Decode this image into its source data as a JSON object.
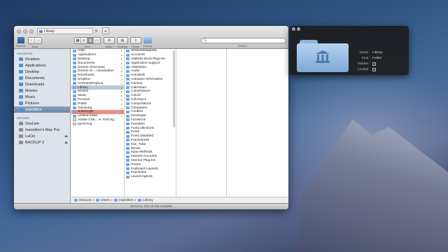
{
  "window": {
    "title": "Library",
    "tab_close": "✕",
    "tab_add": "+"
  },
  "toolbar": {
    "macos_label": "MacOS",
    "back_label": "Back",
    "view_label": "View",
    "action_label": "Action",
    "arrange_label": "Arrange",
    "share_label": "Share",
    "library_label": "Library",
    "search_label": "Search",
    "search_value": "Q"
  },
  "sidebar": {
    "favorites_head": "FAVORITES",
    "favorites": [
      {
        "label": "Dropbox",
        "icon": "dropbox-icon"
      },
      {
        "label": "Applications",
        "icon": "applications-icon"
      },
      {
        "label": "Desktop",
        "icon": "desktop-icon"
      },
      {
        "label": "Documents",
        "icon": "documents-icon"
      },
      {
        "label": "Downloads",
        "icon": "downloads-icon"
      },
      {
        "label": "Movies",
        "icon": "movies-icon"
      },
      {
        "label": "Music",
        "icon": "music-icon"
      },
      {
        "label": "Pictures",
        "icon": "pictures-icon"
      },
      {
        "label": "marioliion",
        "icon": "home-icon"
      }
    ],
    "devices_head": "DEVICES",
    "devices": [
      {
        "label": "OsxLion",
        "icon": "disk-icon"
      },
      {
        "label": "marioliion's Mac Pro",
        "icon": "computer-icon"
      },
      {
        "label": "LaCie",
        "icon": "disk-icon",
        "eject": "⏏"
      },
      {
        "label": "BACKUP 2",
        "icon": "disk-icon",
        "eject": "⏏"
      }
    ]
  },
  "column1": [
    {
      "label": "Adlm",
      "kind": "folder"
    },
    {
      "label": "Applications",
      "kind": "folder"
    },
    {
      "label": "Desktop",
      "kind": "folder"
    },
    {
      "label": "Documents",
      "kind": "folder"
    },
    {
      "label": "Doremi CineAsset",
      "kind": "folder"
    },
    {
      "label": "Doremi Cl... t Evaluation",
      "kind": "folder"
    },
    {
      "label": "Downloads",
      "kind": "folder"
    },
    {
      "label": "Dropbox",
      "kind": "folder"
    },
    {
      "label": "HATeamDropbox",
      "kind": "folder"
    },
    {
      "label": "Library",
      "kind": "folder",
      "selected": true
    },
    {
      "label": "Movies",
      "kind": "folder"
    },
    {
      "label": "Music",
      "kind": "folder"
    },
    {
      "label": "Pictures",
      "kind": "folder"
    },
    {
      "label": "Public",
      "kind": "folder"
    },
    {
      "label": "Samsung",
      "kind": "folder"
    },
    {
      "label": "SolidAngle",
      "kind": "folder",
      "tagged": true
    },
    {
      "label": "untitled folder",
      "kind": "folder"
    },
    {
      "label": "Adobe CS5... er Tool.log",
      "kind": "doc"
    },
    {
      "label": "pymel.log",
      "kind": "doc"
    }
  ],
  "column2": [
    "StickiesDatabase",
    "Accounts",
    "Address Book Plug-Ins",
    "Application Support",
    "Assistants",
    "Audio",
    "Autodesk",
    "Autosave Information",
    "Caches",
    "Calendars",
    "ColorPickers",
    "Colors",
    "ColorSync",
    "Compositions",
    "Containers",
    "Cookies",
    "Developer",
    "Facebook",
    "Favorites",
    "FontCollections",
    "Fonts",
    "Fonts Disabled",
    "Frameworks",
    "Gar_Tube",
    "iMovie",
    "Input Methods",
    "Internet Accounts",
    "Internet Plug-Ins",
    "iTunes",
    "Keyboard Layouts",
    "Keychains",
    "LaunchAgents"
  ],
  "pathbar": [
    "OsxLion",
    "Users",
    "marioliion",
    "Library"
  ],
  "status": "33 items, 202.33 GB available",
  "inspector": {
    "close": "x",
    "info": "i",
    "name_key": "Name :",
    "name_val": "Library",
    "kind_key": "Kind :",
    "kind_val": "Folder",
    "hidden_key": "Hidden :",
    "locked_key": "Locked :"
  }
}
